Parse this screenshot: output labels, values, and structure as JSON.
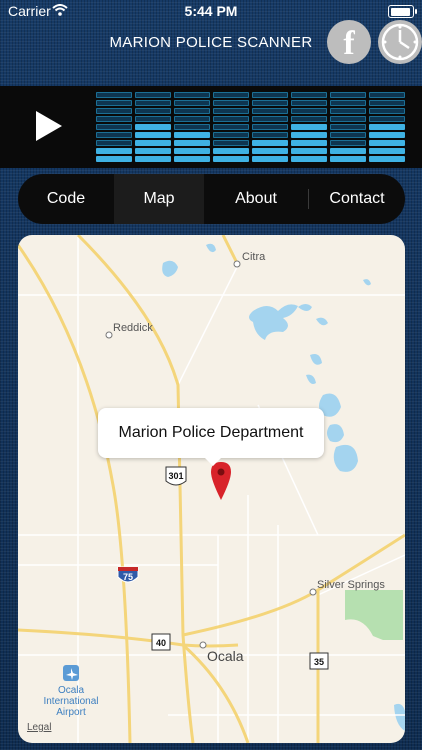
{
  "status_bar": {
    "carrier": "Carrier",
    "time": "5:44 PM"
  },
  "header": {
    "title": "MARION POLICE SCANNER",
    "facebook_glyph": "f"
  },
  "player": {
    "equalizer_levels": [
      0.25,
      0.5,
      0.4,
      0.25,
      0.3,
      0.5,
      0.25,
      0.5
    ]
  },
  "tabs": [
    {
      "label": "Code",
      "active": false
    },
    {
      "label": "Map",
      "active": true
    },
    {
      "label": "About",
      "active": false
    },
    {
      "label": "Contact",
      "active": false
    }
  ],
  "map": {
    "pin_title": "Marion Police Department",
    "places": {
      "citra": "Citra",
      "reddick": "Reddick",
      "silver_springs": "Silver Springs",
      "ocala": "Ocala",
      "airport_line1": "Ocala",
      "airport_line2": "International",
      "airport_line3": "Airport"
    },
    "shields": {
      "us301": "301",
      "i75": "75",
      "sr40": "40",
      "sr35": "35"
    },
    "legal": "Legal"
  },
  "colors": {
    "eq_on": "#3fb2e4",
    "eq_off": "#0e3550",
    "eq_outline": "#1b6f95",
    "pin": "#d8232a",
    "water": "#a4d4ef",
    "park": "#b6e0b0",
    "road_major": "#f4d57a"
  }
}
